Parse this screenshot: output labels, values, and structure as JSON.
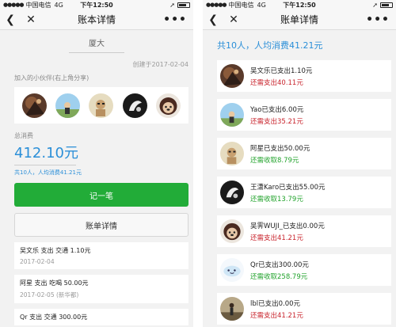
{
  "left_screen": {
    "status_bar": {
      "carrier": "中国电信",
      "network": "4G",
      "time": "下午12:50"
    },
    "nav": {
      "title": "账本详情"
    },
    "book_name": "厦大",
    "created": "创建于2017-02-04",
    "partners_label": "加入的小伙伴(右上角分享)",
    "total_label": "总消费",
    "total_amount": "412.10元",
    "total_sub": "共10人，人均消费41.21元",
    "record_button": "记一笔",
    "details_button": "账单详情",
    "records": [
      {
        "line1": "吴文乐 支出 交通 1.10元",
        "line2": "2017-02-04"
      },
      {
        "line1": "阿星 支出 吃喝 50.00元",
        "line2": "2017-02-05 (新华都)"
      },
      {
        "line1": "Qr 支出 交通 300.00元",
        "line2": ""
      }
    ]
  },
  "right_screen": {
    "status_bar": {
      "carrier": "中国电信",
      "network": "4G",
      "time": "下午12:50"
    },
    "nav": {
      "title": "账单详情"
    },
    "summary": "共10人，人均消费41.21元",
    "people": [
      {
        "spent": "吴文乐已支出1.10元",
        "owe": "还需支出40.11元",
        "type": "pay"
      },
      {
        "spent": "Yao已支出6.00元",
        "owe": "还需支出35.21元",
        "type": "pay"
      },
      {
        "spent": "阿星已支出50.00元",
        "owe": "还需收取8.79元",
        "type": "recv"
      },
      {
        "spent": "王潇Karo已支出55.00元",
        "owe": "还需收取13.79元",
        "type": "recv"
      },
      {
        "spent": "吴霁WUJI_已支出0.00元",
        "owe": "还需支出41.21元",
        "type": "pay"
      },
      {
        "spent": "Qr已支出300.00元",
        "owe": "还需收取258.79元",
        "type": "recv"
      },
      {
        "spent": "lbl已支出0.00元",
        "owe": "还需支出41.21元",
        "type": "pay"
      }
    ]
  },
  "colors": {
    "accent_blue": "#2b8fd8",
    "green": "#22ac38",
    "pay_red": "#c8222b",
    "recv_green": "#22a32c"
  },
  "icons": [
    "back-icon",
    "close-icon",
    "more-icon",
    "signal-icon",
    "location-icon",
    "battery-icon"
  ]
}
